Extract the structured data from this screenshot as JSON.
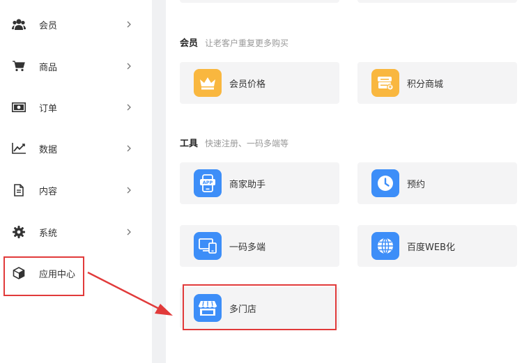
{
  "sidebar": {
    "items": [
      {
        "label": "会员",
        "icon": "users-icon"
      },
      {
        "label": "商品",
        "icon": "cart-icon"
      },
      {
        "label": "订单",
        "icon": "money-icon"
      },
      {
        "label": "数据",
        "icon": "chart-line-icon"
      },
      {
        "label": "内容",
        "icon": "document-icon"
      },
      {
        "label": "系统",
        "icon": "gear-icon"
      },
      {
        "label": "应用中心",
        "icon": "cube-icon"
      }
    ]
  },
  "sections": {
    "member": {
      "title": "会员",
      "subtitle": "让老客户重复更多购买",
      "cards": [
        {
          "label": "会员价格",
          "icon": "crown-icon",
          "color": "#f9b73f"
        },
        {
          "label": "积分商城",
          "icon": "points-mall-icon",
          "color": "#f9b73f"
        }
      ]
    },
    "tools": {
      "title": "工具",
      "subtitle": "快速注册、一码多端等",
      "cards": [
        {
          "label": "商家助手",
          "icon": "app-phone-icon",
          "color": "#3d8ef8"
        },
        {
          "label": "预约",
          "icon": "clock-icon",
          "color": "#3d8ef8"
        },
        {
          "label": "一码多端",
          "icon": "multi-device-icon",
          "color": "#3d8ef8"
        },
        {
          "label": "百度WEB化",
          "icon": "globe-icon",
          "color": "#3d8ef8"
        },
        {
          "label": "多门店",
          "icon": "store-icon",
          "color": "#3d8ef8"
        }
      ]
    }
  },
  "colors": {
    "highlight": "#e13a3a",
    "accent_blue": "#3d8ef8",
    "accent_orange": "#f9b73f"
  }
}
